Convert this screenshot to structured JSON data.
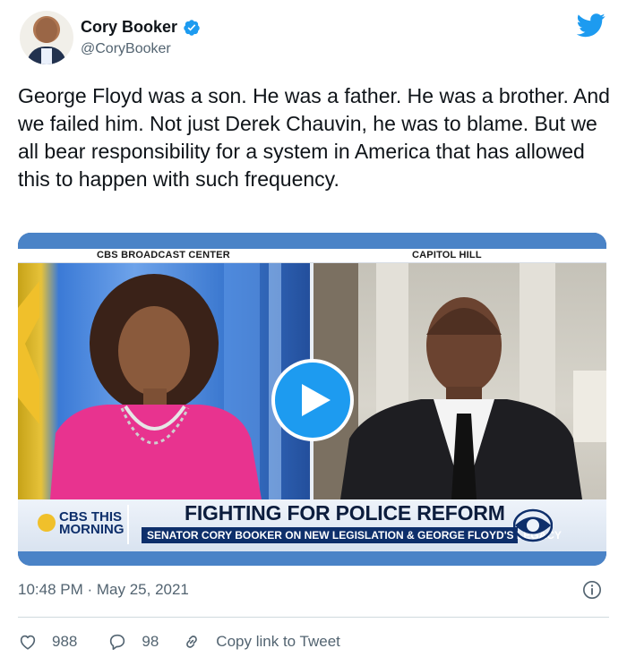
{
  "author": {
    "name": "Cory Booker",
    "handle": "@CoryBooker",
    "verified": true
  },
  "tweet": {
    "text": "George Floyd was a son. He was a father. He was a brother. And we failed him. Not just Derek Chauvin, he was to blame. But we all bear responsibility for a system in America that has allowed this to happen with such frequency."
  },
  "video": {
    "left_location": "CBS BROADCAST CENTER",
    "right_location": "CAPITOL HILL",
    "logo_line1": "CBS THIS",
    "logo_line2": "MORNING",
    "headline": "FIGHTING FOR POLICE REFORM",
    "subheadline": "SENATOR CORY BOOKER ON NEW LEGISLATION & GEORGE FLOYD'S LEGACY"
  },
  "meta": {
    "timestamp": "10:48 PM · May 25, 2021"
  },
  "actions": {
    "likes": "988",
    "replies": "98",
    "copy_link": "Copy link to Tweet"
  },
  "colors": {
    "brand_blue": "#1d9bf0",
    "secondary_text": "#536471",
    "divider": "#cfd9de"
  }
}
